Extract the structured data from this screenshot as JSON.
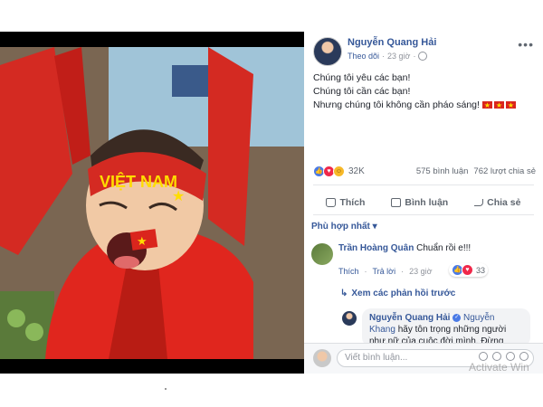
{
  "post": {
    "author": "Nguyễn Quang Hải",
    "follow_label": "Theo dõi",
    "time": "23 giờ",
    "caption_lines": [
      "Chúng tôi yêu các bạn!",
      "Chúng tôi cần các bạn!",
      "Nhưng chúng tôi không cần pháo sáng!"
    ],
    "reaction_count": "32K",
    "comments_count": "575 bình luận",
    "shares_count": "762 lượt chia sẻ",
    "actions": {
      "like": "Thích",
      "comment": "Bình luận",
      "share": "Chia sẻ"
    },
    "image_text": "VIỆT NAM"
  },
  "comments": {
    "sort_label": "Phù hợp nhất",
    "items": [
      {
        "name": "Trần Hoàng Quân",
        "text": "Chuẩn rồi e!!!",
        "like": "Thích",
        "reply": "Trả lời",
        "time": "23 giờ",
        "reaction_count": "33"
      }
    ],
    "view_replies": "Xem các phản hồi trước",
    "reply": {
      "name": "Nguyễn Quang Hải",
      "mention": "Nguyễn Khang",
      "text": "hãy tôn trọng những người như nữ của cuộc đời mình. Đừng"
    },
    "input_placeholder": "Viết bình luận..."
  },
  "watermark": "Activate Win",
  "colors": {
    "link": "#365899",
    "flag_red": "#da251d",
    "flag_star": "#ffdd00"
  }
}
